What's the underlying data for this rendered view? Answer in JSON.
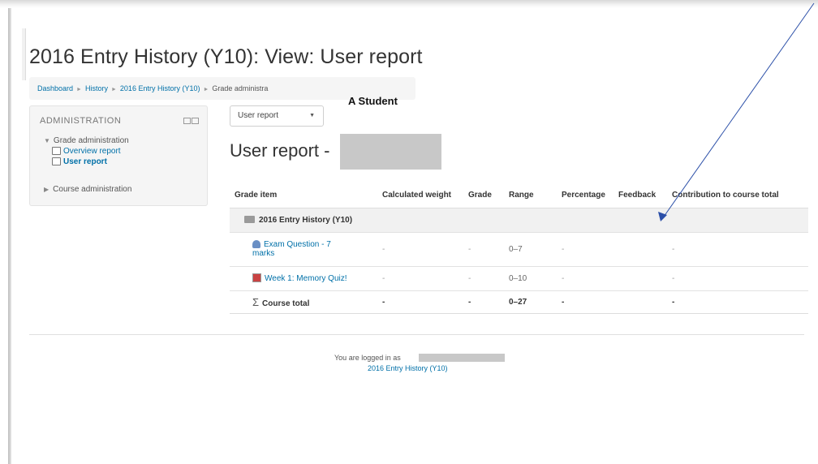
{
  "page": {
    "title": "2016 Entry History (Y10): View: User report"
  },
  "breadcrumb": {
    "items": [
      "Dashboard",
      "History",
      "2016 Entry History (Y10)"
    ],
    "current": "Grade administra"
  },
  "annotation": {
    "student_label": "A Student",
    "arrow_color": "#2b4fa8"
  },
  "admin": {
    "title": "ADMINISTRATION",
    "grade_admin": "Grade administration",
    "overview_report": "Overview report",
    "user_report": "User report",
    "course_admin": "Course administration"
  },
  "report_select": {
    "value": "User report"
  },
  "user_heading": "User report -",
  "table": {
    "headers": [
      "Grade item",
      "Calculated weight",
      "Grade",
      "Range",
      "Percentage",
      "Feedback",
      "Contribution to course total"
    ],
    "category": "2016 Entry History (Y10)",
    "rows": [
      {
        "item_line1": "Exam Question - 7",
        "item_line2": "marks",
        "weight": "-",
        "grade": "-",
        "range": "0–7",
        "percentage": "-",
        "feedback": "",
        "contribution": "-"
      },
      {
        "item": "Week 1: Memory Quiz!",
        "weight": "-",
        "grade": "-",
        "range": "0–10",
        "percentage": "-",
        "feedback": "",
        "contribution": "-"
      }
    ],
    "total": {
      "item": "Course total",
      "weight": "-",
      "grade": "-",
      "range": "0–27",
      "percentage": "-",
      "feedback": "",
      "contribution": "-"
    }
  },
  "footer": {
    "logged_in_text": "You are logged in as",
    "course_link": "2016 Entry History (Y10)"
  },
  "colors": {
    "link": "#0070a8",
    "redaction": "#c8c8c8"
  }
}
